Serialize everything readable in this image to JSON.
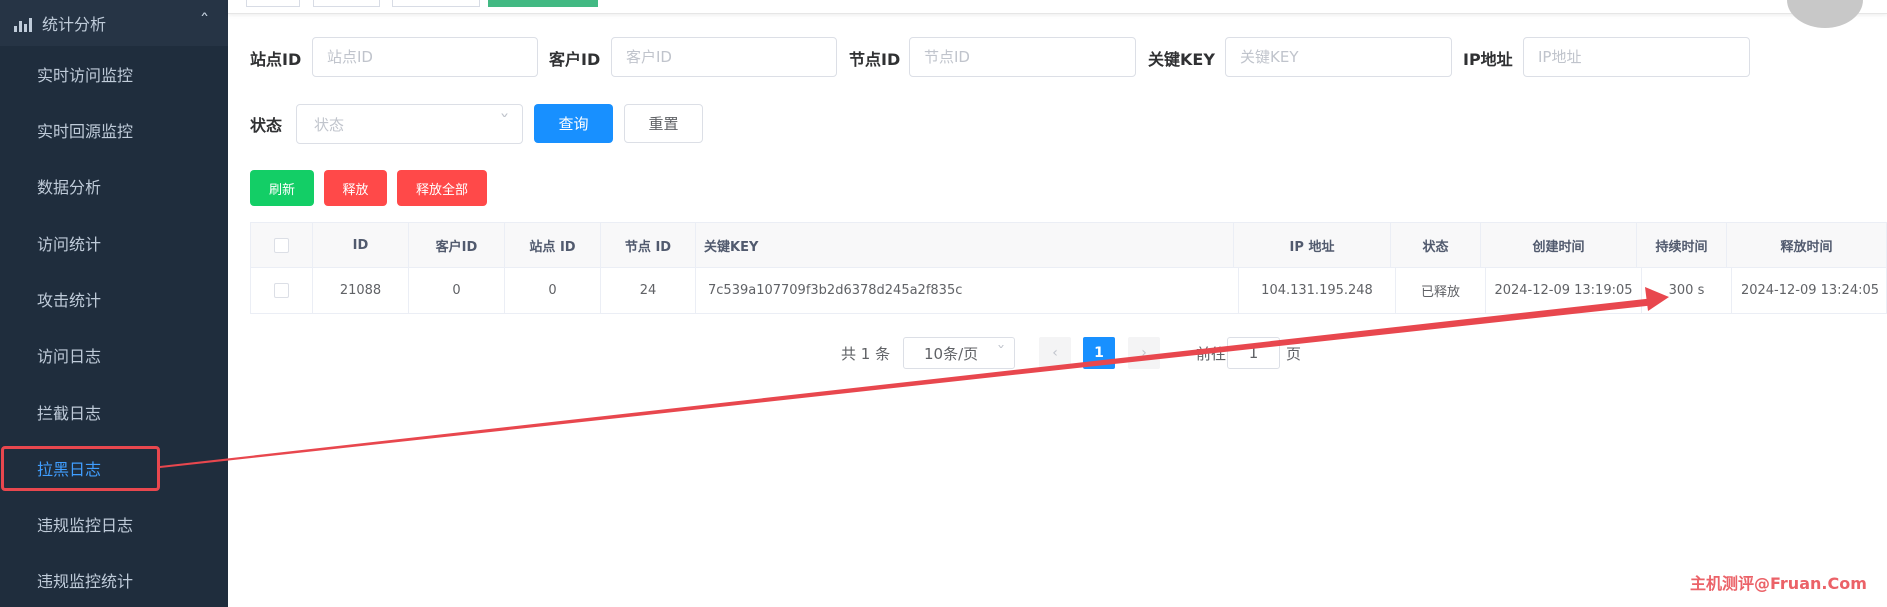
{
  "sidebar": {
    "section": {
      "label": "统计分析",
      "icon": "bar-chart-icon",
      "chevron": "chevron-up-icon"
    },
    "items": [
      {
        "label": "实时访问监控"
      },
      {
        "label": "实时回源监控"
      },
      {
        "label": "数据分析"
      },
      {
        "label": "访问统计"
      },
      {
        "label": "攻击统计"
      },
      {
        "label": "访问日志"
      },
      {
        "label": "拦截日志"
      },
      {
        "label": "拉黑日志",
        "active": true
      },
      {
        "label": "违规监控日志"
      },
      {
        "label": "违规监控统计"
      }
    ]
  },
  "filters": {
    "site_id": {
      "label": "站点ID",
      "placeholder": "站点ID"
    },
    "customer_id": {
      "label": "客户ID",
      "placeholder": "客户ID"
    },
    "node_id": {
      "label": "节点ID",
      "placeholder": "节点ID"
    },
    "key": {
      "label": "关键KEY",
      "placeholder": "关键KEY"
    },
    "ip": {
      "label": "IP地址",
      "placeholder": "IP地址"
    },
    "status": {
      "label": "状态",
      "placeholder": "状态"
    },
    "query_label": "查询",
    "reset_label": "重置"
  },
  "actions": {
    "refresh_label": "刷新",
    "release_label": "释放",
    "release_all_label": "释放全部"
  },
  "table": {
    "headers": [
      "ID",
      "客户ID",
      "站点 ID",
      "节点 ID",
      "关键KEY",
      "IP 地址",
      "状态",
      "创建时间",
      "持续时间",
      "释放时间"
    ],
    "rows": [
      [
        "21088",
        "0",
        "0",
        "24",
        "7c539a107709f3b2d6378d245a2f835c",
        "104.131.195.248",
        "已释放",
        "2024-12-09 13:19:05",
        "300 s",
        "2024-12-09 13:24:05"
      ]
    ]
  },
  "pagination": {
    "total": "共 1 条",
    "page_size": "10条/页",
    "current": "1",
    "goto_label": "前往",
    "jump_value": "1",
    "page_label": "页"
  },
  "colors": {
    "sidebar_bg": "#1f2d3d",
    "primary": "#1890ff",
    "success": "#13ce66",
    "danger": "#ff4949",
    "annotation": "#e8474e"
  },
  "watermark": "主机测评@Fruan.Com"
}
